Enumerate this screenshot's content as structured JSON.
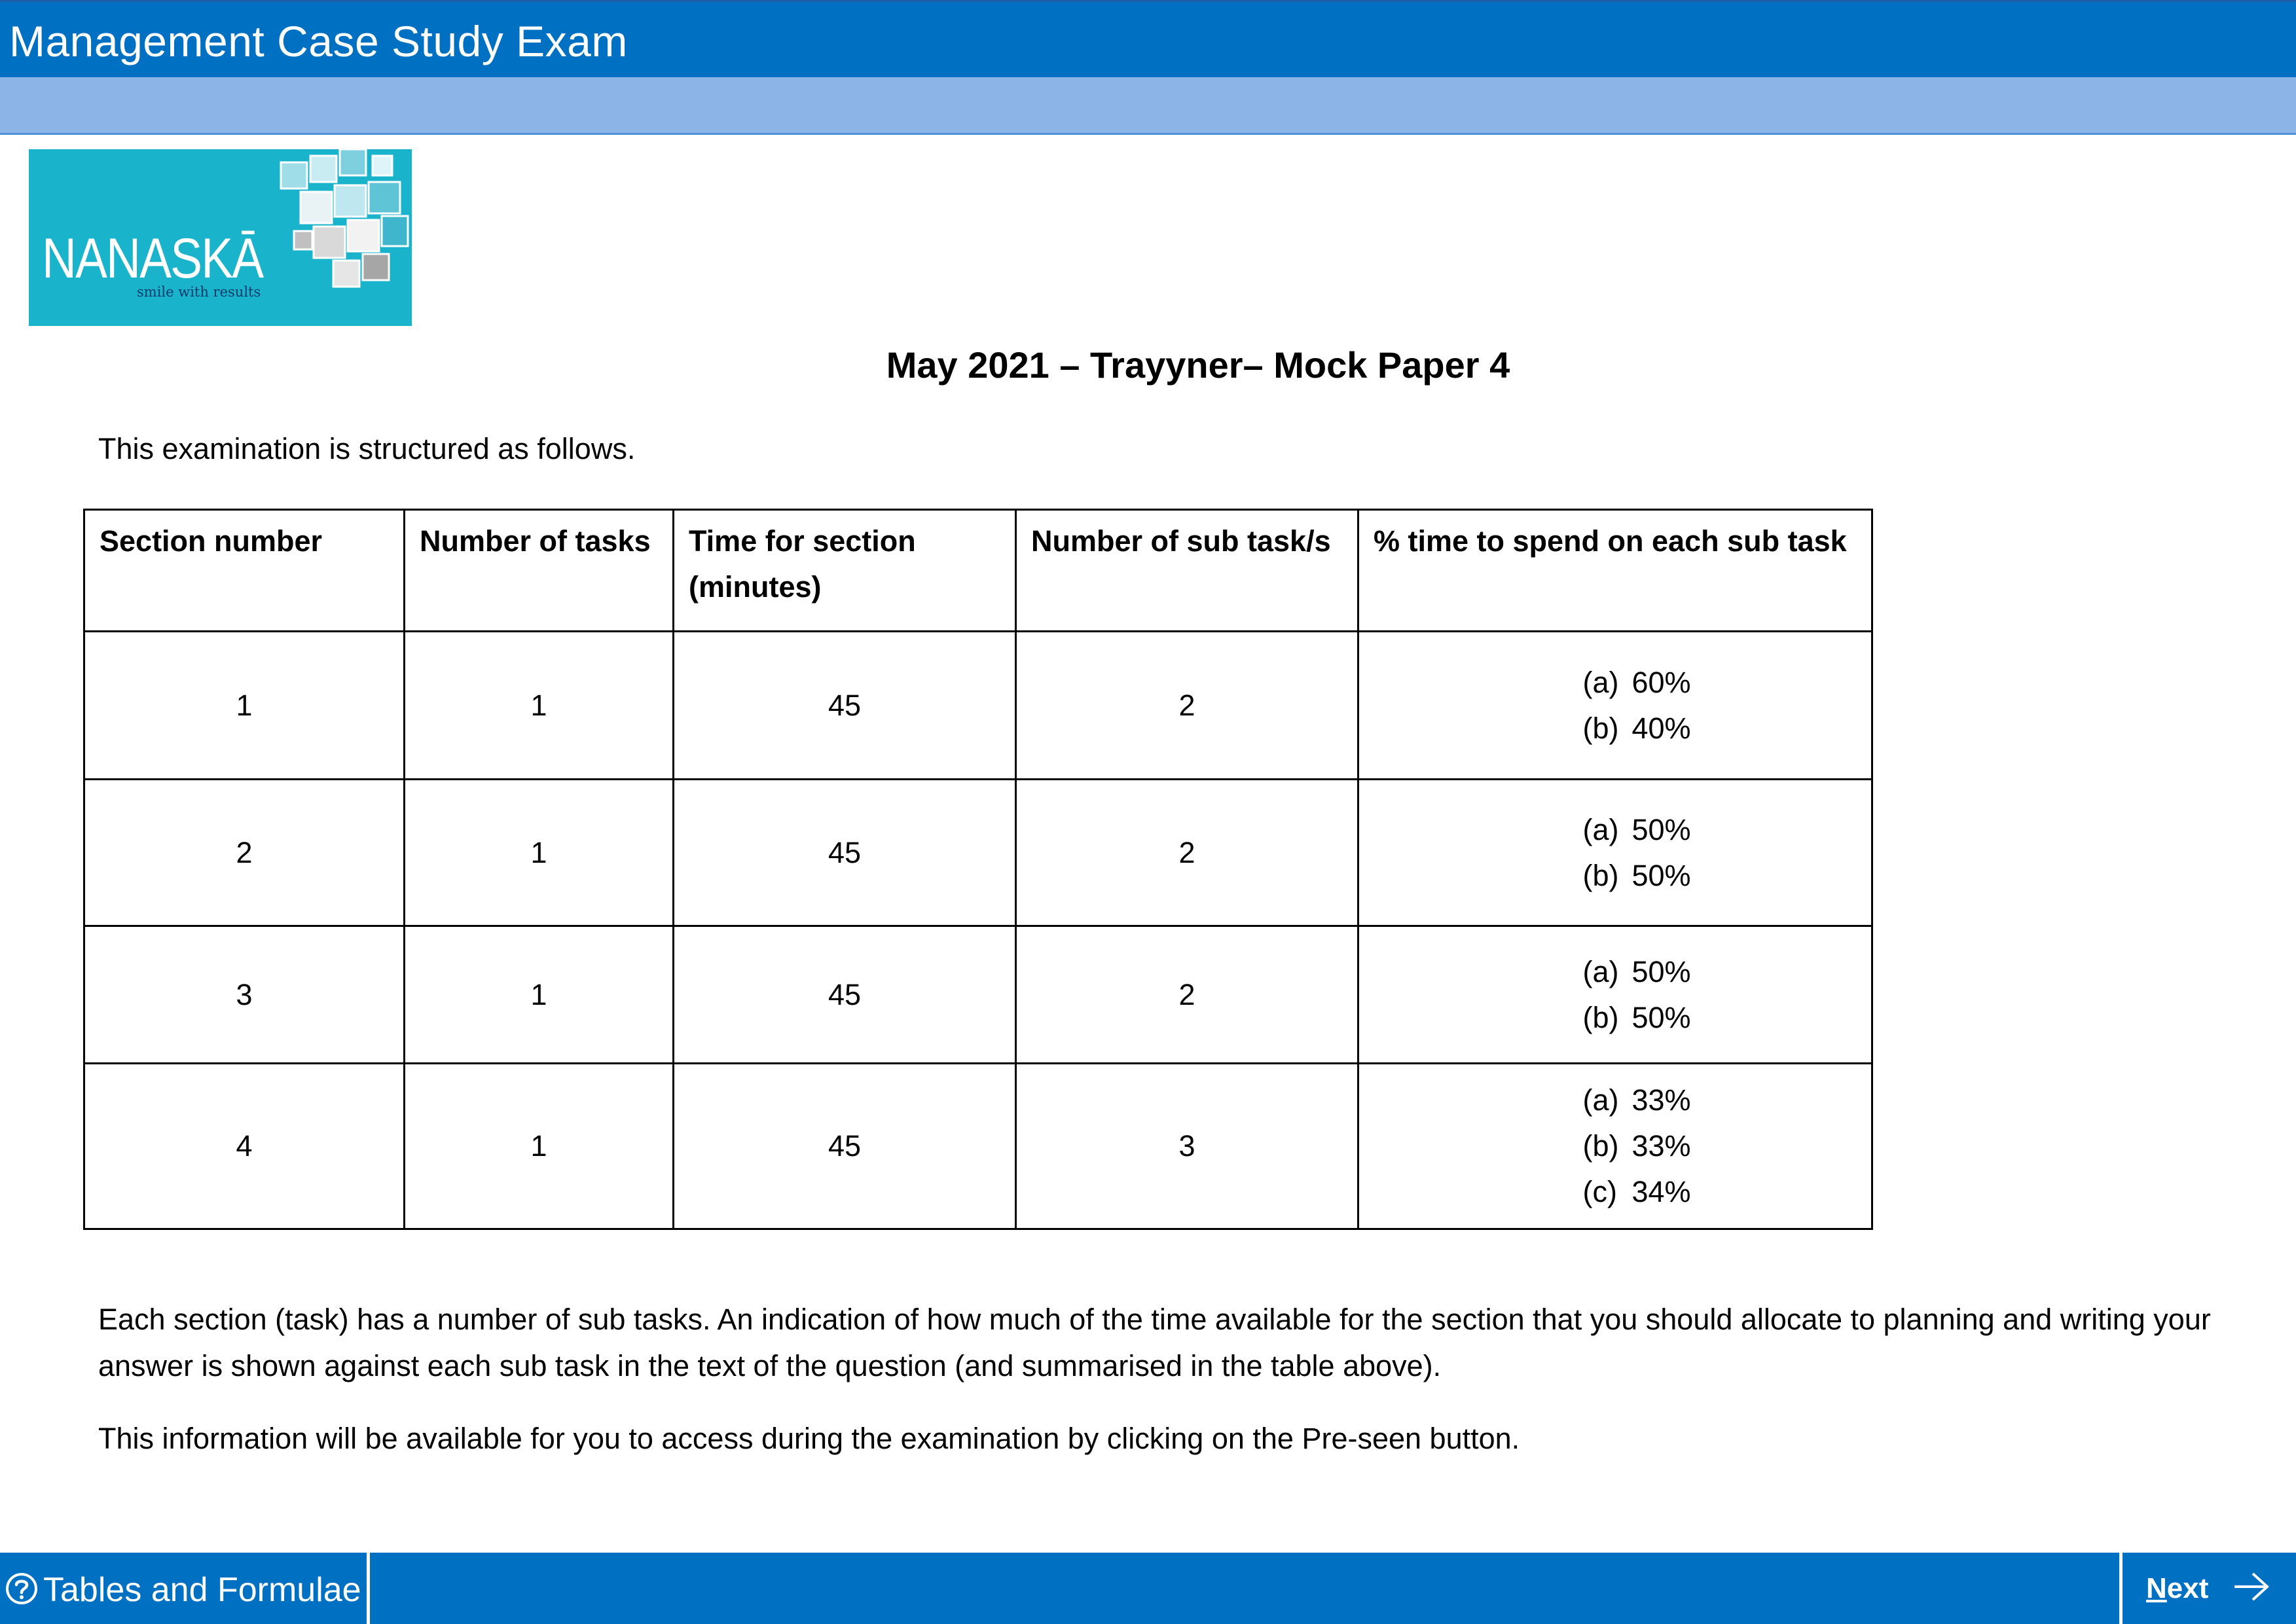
{
  "window": {
    "title": "Management Case Study Exam"
  },
  "logo": {
    "name": "NANASKĀ",
    "tagline": "smile with results",
    "background_color": "#19b3cb"
  },
  "paper": {
    "heading": "May 2021 – Trayyner– Mock Paper 4",
    "intro": "This examination is structured as follows."
  },
  "table": {
    "headers": [
      "Section number",
      "Number of tasks",
      "Time for section (minutes)",
      "Number of sub task/s",
      "% time to spend on each sub task"
    ],
    "rows": [
      {
        "section": "1",
        "tasks": "1",
        "time": "45",
        "subtasks": "2",
        "allocation": [
          {
            "label": "(a)",
            "value": "60%"
          },
          {
            "label": "(b)",
            "value": "40%"
          }
        ]
      },
      {
        "section": "2",
        "tasks": "1",
        "time": "45",
        "subtasks": "2",
        "allocation": [
          {
            "label": "(a)",
            "value": "50%"
          },
          {
            "label": "(b)",
            "value": "50%"
          }
        ]
      },
      {
        "section": "3",
        "tasks": "1",
        "time": "45",
        "subtasks": "2",
        "allocation": [
          {
            "label": "(a)",
            "value": "50%"
          },
          {
            "label": "(b)",
            "value": "50%"
          }
        ]
      },
      {
        "section": "4",
        "tasks": "1",
        "time": "45",
        "subtasks": "3",
        "allocation": [
          {
            "label": "(a)",
            "value": "33%"
          },
          {
            "label": "(b)",
            "value": "33%"
          },
          {
            "label": "(c)",
            "value": "34%"
          }
        ]
      }
    ]
  },
  "body": {
    "paragraph_1": "Each section (task) has a number of sub tasks. An indication of how much of the time available for the section that you should allocate to planning and writing your answer is shown against each sub task in the text of the question (and summarised in the table above).",
    "paragraph_2": "This information will be available for you to access during the examination by clicking on the Pre-seen button."
  },
  "footer": {
    "tables_button_label": "Tables and Formulae",
    "tables_icon": "help-circle-icon",
    "next_button_label": "Next",
    "next_icon": "arrow-right-icon"
  },
  "colors": {
    "title_bar": "#0070c3",
    "sub_bar": "#8db4e6",
    "footer_bar": "#0070c3"
  }
}
